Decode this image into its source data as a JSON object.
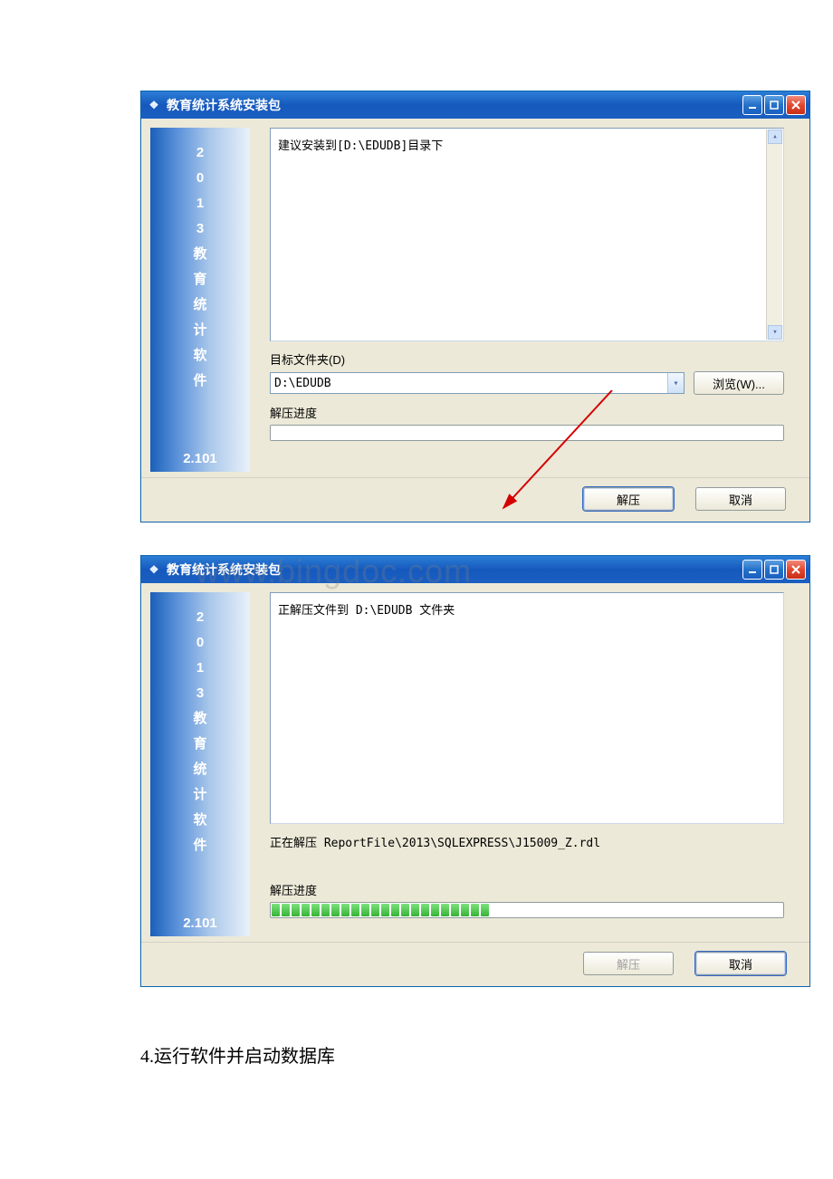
{
  "watermark": "www.bingdoc.com",
  "dialog1": {
    "title": "教育统计系统安装包",
    "sidebar": {
      "chars": [
        "2",
        "0",
        "1",
        "3",
        "教",
        "育",
        "统",
        "计",
        "软",
        "件"
      ],
      "version": "2.101"
    },
    "info_text": "建议安装到[D:\\EDUDB]目录下",
    "target_label": "目标文件夹(D)",
    "path_value": "D:\\EDUDB",
    "browse_label": "浏览(W)...",
    "progress_label": "解压进度",
    "extract_label": "解压",
    "cancel_label": "取消"
  },
  "dialog2": {
    "title": "教育统计系统安装包",
    "sidebar": {
      "chars": [
        "2",
        "0",
        "1",
        "3",
        "教",
        "育",
        "统",
        "计",
        "软",
        "件"
      ],
      "version": "2.101"
    },
    "info_text": "正解压文件到 D:\\EDUDB 文件夹",
    "status_text": "正在解压 ReportFile\\2013\\SQLEXPRESS\\J15009_Z.rdl",
    "progress_label": "解压进度",
    "progress_blocks": 22,
    "extract_label": "解压",
    "cancel_label": "取消"
  },
  "caption": "4.运行软件并启动数据库"
}
